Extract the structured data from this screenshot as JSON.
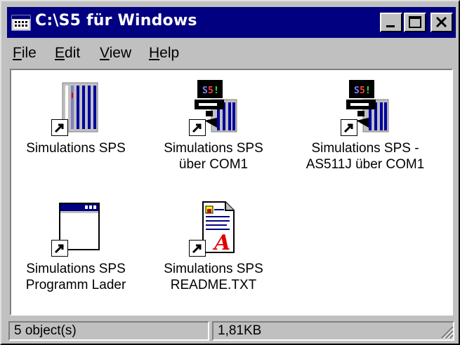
{
  "window": {
    "title": "C:\\S5 für Windows"
  },
  "menu": [
    {
      "label": "File",
      "key": "F",
      "rest": "ile"
    },
    {
      "label": "Edit",
      "key": "E",
      "rest": "dit"
    },
    {
      "label": "View",
      "key": "V",
      "rest": "iew"
    },
    {
      "label": "Help",
      "key": "H",
      "rest": "elp"
    }
  ],
  "items": [
    {
      "line1": "Simulations SPS",
      "line2": "",
      "icon": "plc-rack-shortcut-icon"
    },
    {
      "line1": "Simulations SPS",
      "line2": "über COM1",
      "icon": "plc-monitor-shortcut-icon"
    },
    {
      "line1": "Simulations SPS -",
      "line2": "AS511J über COM1",
      "icon": "plc-monitor-shortcut-icon"
    },
    {
      "line1": "Simulations SPS",
      "line2": "Programm Lader",
      "icon": "program-window-shortcut-icon"
    },
    {
      "line1": "Simulations SPS",
      "line2": "README.TXT",
      "icon": "text-document-shortcut-icon"
    }
  ],
  "status": {
    "objects": "5 object(s)",
    "size": "1,81KB"
  },
  "colors": {
    "titlebar": "#000080",
    "face": "#c0c0c0",
    "content": "#ffffff"
  }
}
